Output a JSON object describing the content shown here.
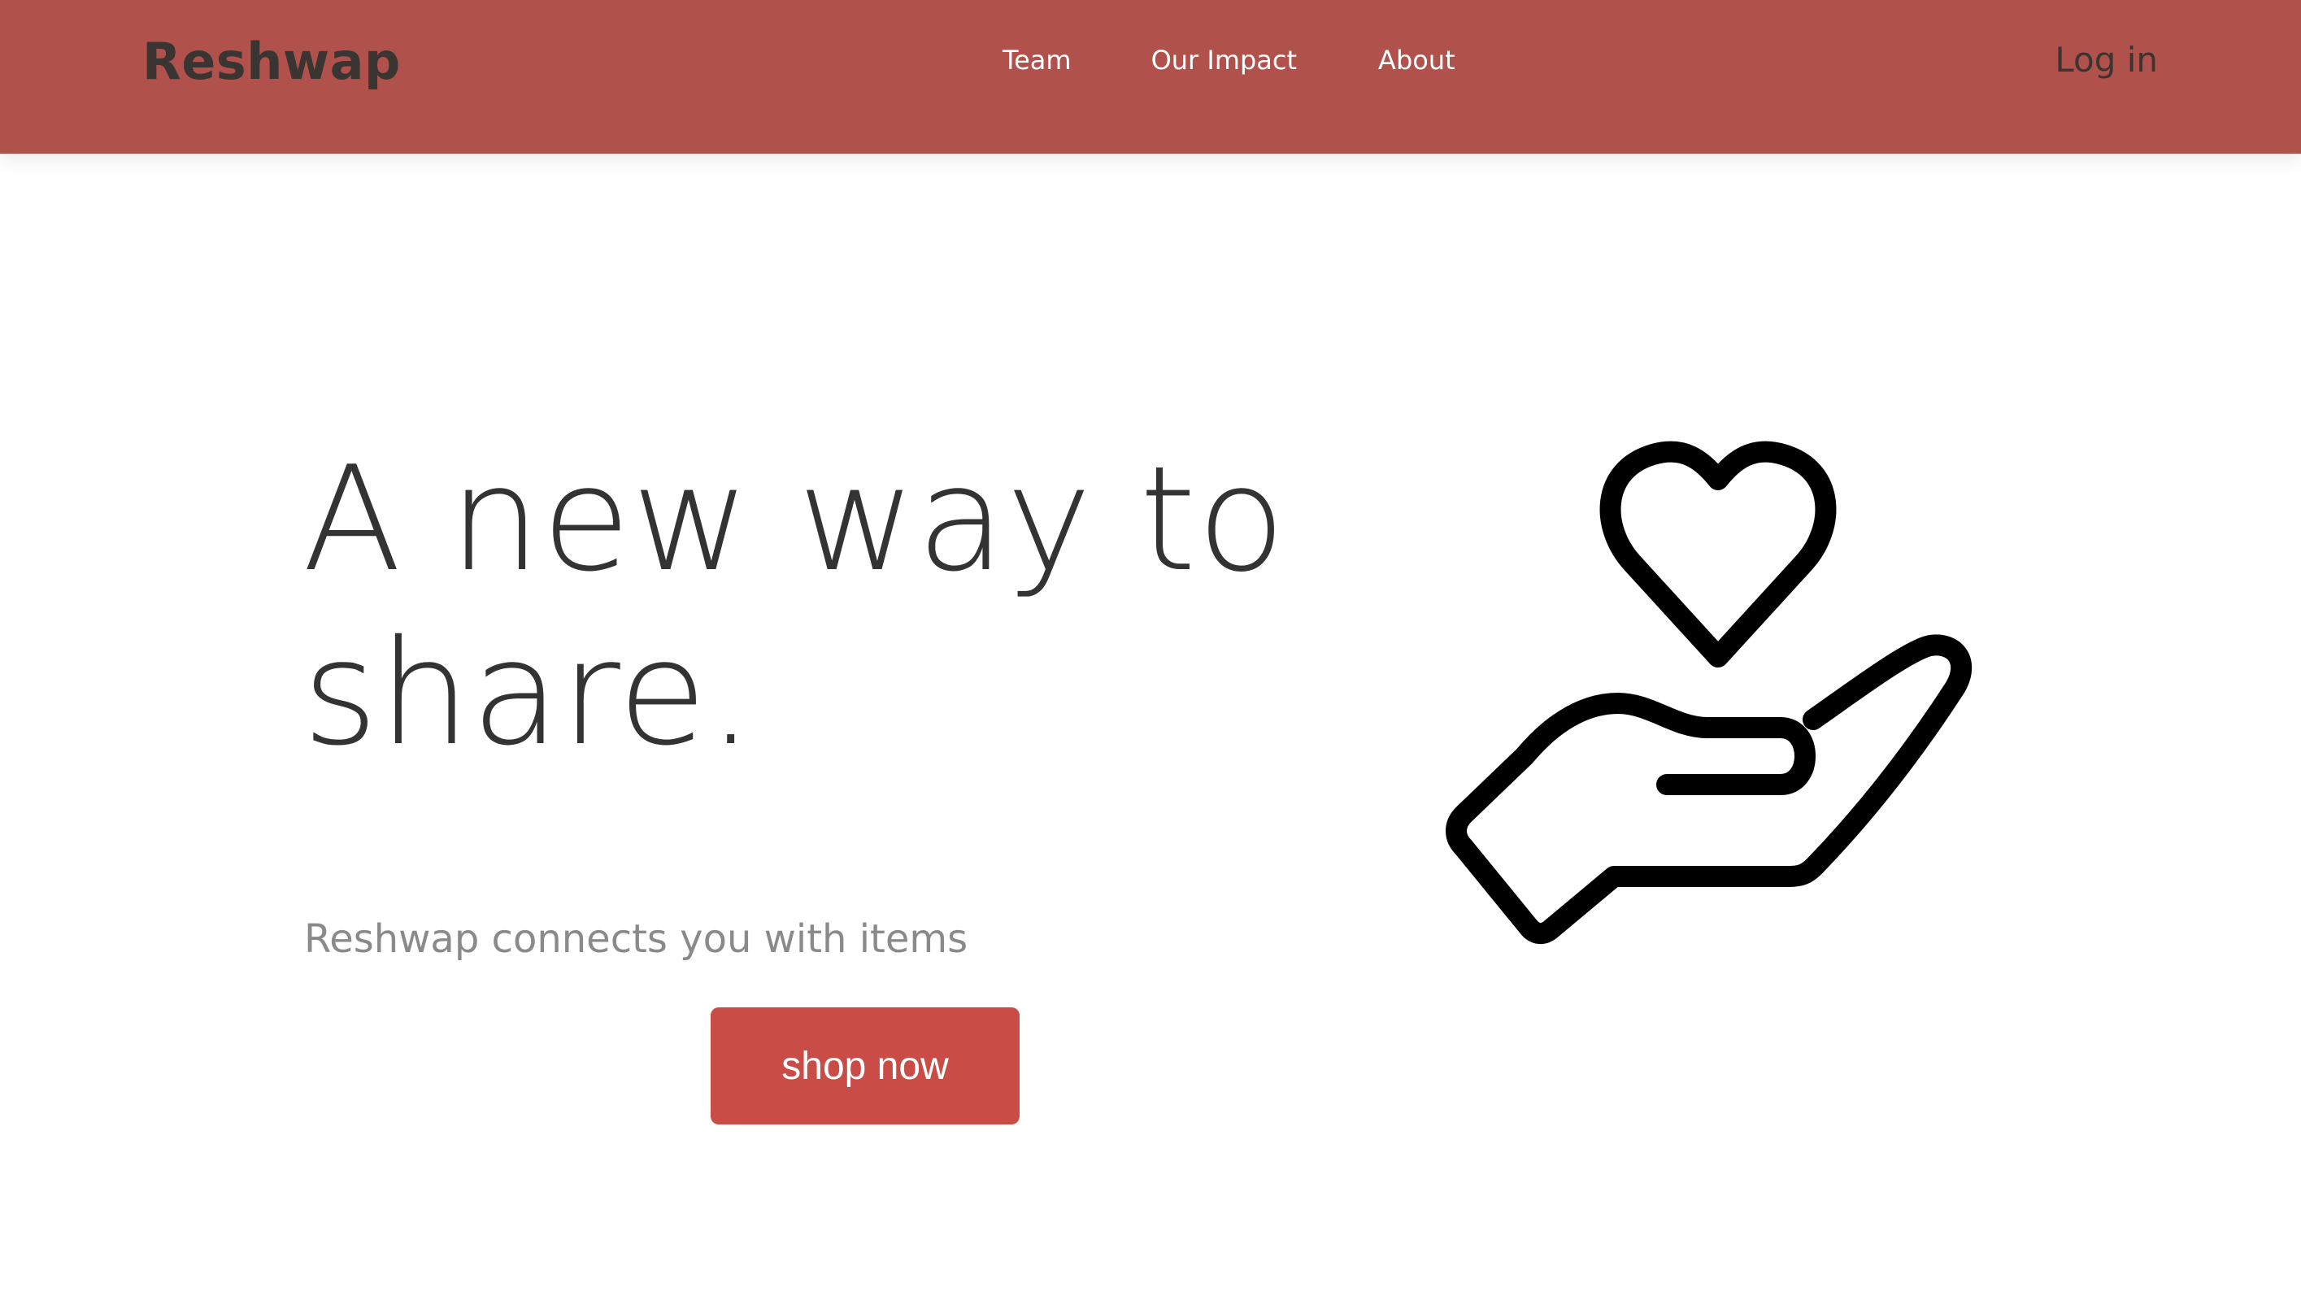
{
  "header": {
    "brand": "Reshwap",
    "nav": {
      "team": "Team",
      "impact": "Our Impact",
      "about": "About"
    },
    "login": "Log in",
    "background_color": "#b0524b"
  },
  "hero": {
    "title_line1": "A new way to",
    "title_line2": "share.",
    "subtitle": "Reshwap connects you with items",
    "cta_label": "shop now",
    "cta_color": "#c94c47",
    "illustration_icon": "heart-in-hand-icon"
  }
}
